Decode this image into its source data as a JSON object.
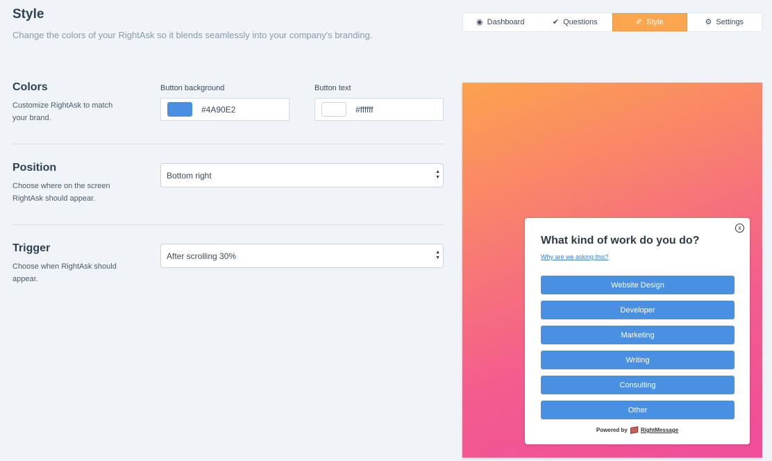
{
  "header": {
    "title": "Style",
    "subtitle": "Change the colors of your RightAsk so it blends seamlessly into your company's branding."
  },
  "tabs": [
    {
      "label": "Dashboard",
      "icon": "dashboard-icon",
      "active": false
    },
    {
      "label": "Questions",
      "icon": "check-icon",
      "active": false
    },
    {
      "label": "Style",
      "icon": "brush-icon",
      "active": true
    },
    {
      "label": "Settings",
      "icon": "gear-icon",
      "active": false
    }
  ],
  "colors": {
    "heading": "Colors",
    "description": "Customize RightAsk to match your brand.",
    "button_background_label": "Button background",
    "button_background_value": "#4A90E2",
    "button_text_label": "Button text",
    "button_text_value": "#ffffff"
  },
  "position": {
    "heading": "Position",
    "description": "Choose where on the screen RightAsk should appear.",
    "selected": "Bottom right"
  },
  "trigger": {
    "heading": "Trigger",
    "description": "Choose when RightAsk should appear.",
    "selected": "After scrolling 30%"
  },
  "preview": {
    "question": "What kind of work do you do?",
    "why_link": "Why are we asking this?",
    "answers": [
      "Website Design",
      "Developer",
      "Marketing",
      "Writing",
      "Consulting",
      "Other"
    ],
    "powered_by": "Powered by",
    "brand": "RightMessage",
    "close_symbol": "x"
  },
  "theme": {
    "accent_tab": "#fca64f",
    "button_color": "#4a90e2"
  }
}
